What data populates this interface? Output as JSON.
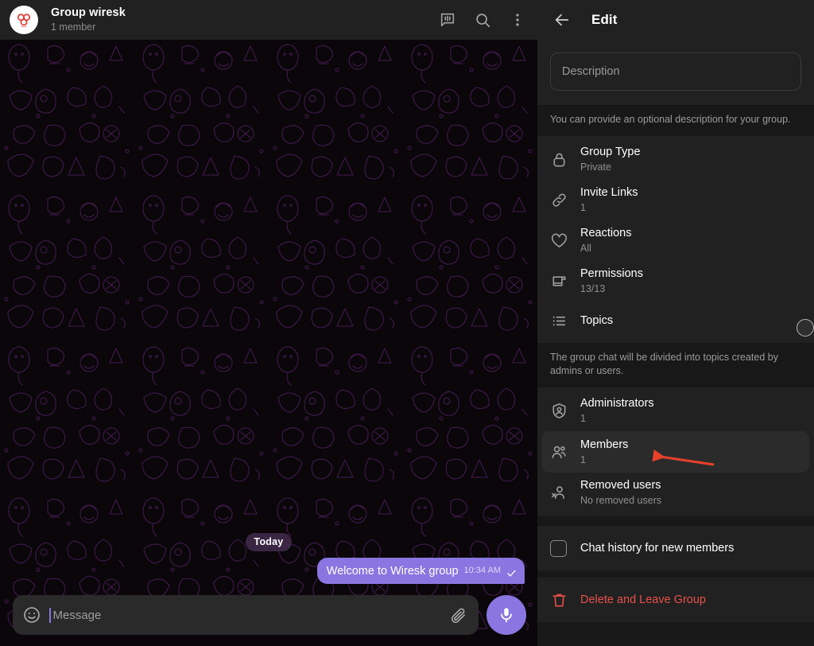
{
  "chat": {
    "header": {
      "avatar_icon": "group-logo-flower",
      "title": "Group wiresk",
      "subtitle": "1 member",
      "icons": [
        {
          "name": "poll-icon",
          "glyph": "poll"
        },
        {
          "name": "search-icon",
          "glyph": "search"
        },
        {
          "name": "more-options-icon",
          "glyph": "kebab"
        }
      ]
    },
    "date_divider": "Today",
    "messages": [
      {
        "text": "Welcome to Wiresk group",
        "time": "10:34 AM",
        "status_icon": "single-check-icon",
        "outgoing": true,
        "bubble_color": "#8976e0"
      }
    ],
    "composer": {
      "emoji_icon": "smiley-icon",
      "placeholder": "Message",
      "value": "",
      "attach_icon": "paperclip-icon",
      "mic_icon": "microphone-icon",
      "mic_color": "#8976e0"
    }
  },
  "edit_panel": {
    "back_icon": "arrow-left-icon",
    "title": "Edit",
    "description": {
      "placeholder": "Description",
      "value": "",
      "hint": "You can provide an optional description for your group."
    },
    "settings": [
      {
        "icon": "lock-icon",
        "label": "Group Type",
        "value": "Private"
      },
      {
        "icon": "link-icon",
        "label": "Invite Links",
        "value": "1"
      },
      {
        "icon": "heart-icon",
        "label": "Reactions",
        "value": "All"
      },
      {
        "icon": "permissions-icon",
        "label": "Permissions",
        "value": "13/13"
      }
    ],
    "topics": {
      "icon": "list-icon",
      "label": "Topics",
      "toggle_on": false,
      "hint": "The group chat will be divided into topics created by admins or users."
    },
    "people": [
      {
        "icon": "shield-person-icon",
        "label": "Administrators",
        "value": "1",
        "highlighted": false
      },
      {
        "icon": "members-icon",
        "label": "Members",
        "value": "1",
        "highlighted": true
      },
      {
        "icon": "removed-user-icon",
        "label": "Removed users",
        "value": "No removed users",
        "highlighted": false
      }
    ],
    "chat_history": {
      "icon": "checkbox-icon",
      "label": "Chat history for new members",
      "checked": false
    },
    "delete": {
      "icon": "trash-icon",
      "label": "Delete and Leave Group",
      "color": "#e8504a"
    }
  },
  "annotation": {
    "arrow_color": "#e8412a",
    "points_at": "Members"
  }
}
